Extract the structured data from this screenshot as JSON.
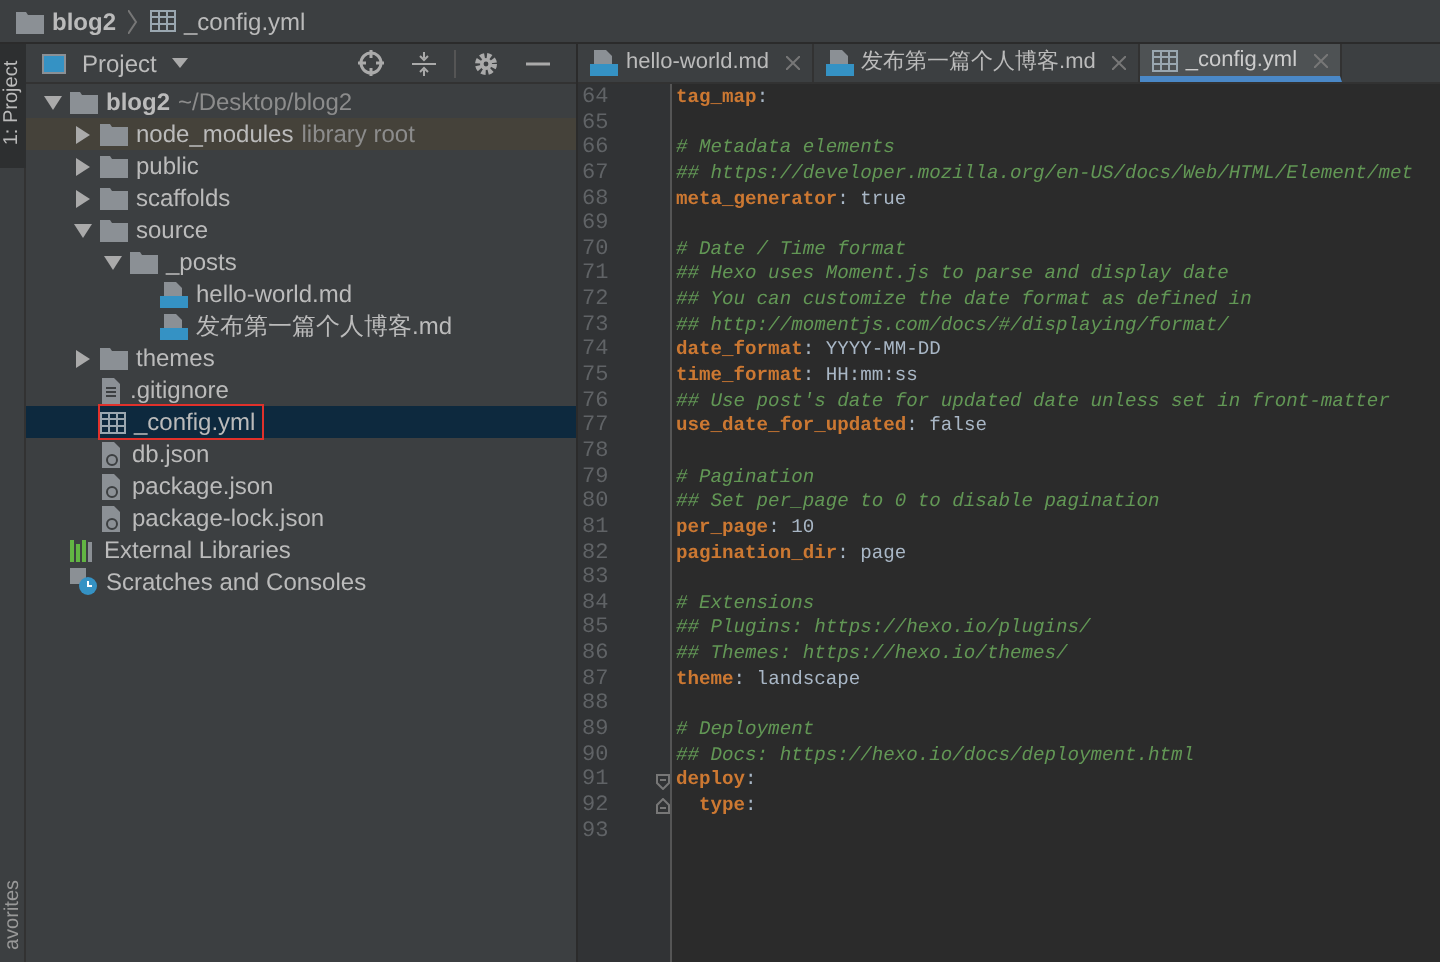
{
  "breadcrumb": [
    {
      "label": "blog2",
      "kind": "folder"
    },
    {
      "label": "_config.yml",
      "kind": "table"
    }
  ],
  "side_strip": {
    "top_tab": "1: Project",
    "bottom_tab": "avorites"
  },
  "project_panel": {
    "title": "Project",
    "tree": [
      {
        "label": "blog2",
        "note": "~/Desktop/blog2",
        "kind": "folder",
        "expanded": true,
        "selected": false,
        "children": [
          {
            "label": "node_modules",
            "note": "library root",
            "kind": "folder",
            "expanded": false,
            "hovered": true,
            "selected": false
          },
          {
            "label": "public",
            "kind": "folder",
            "expanded": false,
            "selected": false
          },
          {
            "label": "scaffolds",
            "kind": "folder",
            "expanded": false,
            "selected": false
          },
          {
            "label": "source",
            "kind": "folder",
            "expanded": true,
            "selected": false,
            "children": [
              {
                "label": "_posts",
                "kind": "folder",
                "expanded": true,
                "selected": false,
                "children": [
                  {
                    "label": "hello-world.md",
                    "kind": "md",
                    "selected": false
                  },
                  {
                    "label": "发布第一篇个人博客.md",
                    "kind": "md",
                    "selected": false
                  }
                ]
              }
            ]
          },
          {
            "label": "themes",
            "kind": "folder",
            "expanded": false,
            "selected": false
          },
          {
            "label": ".gitignore",
            "kind": "text",
            "selected": false
          },
          {
            "label": "_config.yml",
            "kind": "table",
            "selected": true,
            "annotated": true
          },
          {
            "label": "db.json",
            "kind": "json",
            "selected": false
          },
          {
            "label": "package.json",
            "kind": "json",
            "selected": false
          },
          {
            "label": "package-lock.json",
            "kind": "json",
            "selected": false
          }
        ]
      },
      {
        "label": "External Libraries",
        "kind": "libraries",
        "selected": false
      },
      {
        "label": "Scratches and Consoles",
        "kind": "scratches",
        "selected": false
      }
    ]
  },
  "editor_tabs": [
    {
      "label": "hello-world.md",
      "kind": "md",
      "selected": false
    },
    {
      "label": "发布第一篇个人博客.md",
      "kind": "md",
      "selected": false
    },
    {
      "label": "_config.yml",
      "kind": "table",
      "selected": true
    }
  ],
  "code_lines": [
    {
      "number": "64",
      "segments": [
        {
          "kind": "key",
          "text": "tag_map"
        },
        {
          "kind": "plain",
          "text": ":"
        }
      ]
    },
    {
      "number": "65"
    },
    {
      "number": "66",
      "segments": [
        {
          "kind": "comment",
          "text": "# Metadata elements"
        }
      ]
    },
    {
      "number": "67",
      "segments": [
        {
          "kind": "comment",
          "text": "## https://developer.mozilla.org/en-US/docs/Web/HTML/Element/met"
        }
      ]
    },
    {
      "number": "68",
      "segments": [
        {
          "kind": "key",
          "text": "meta_generator"
        },
        {
          "kind": "plain",
          "text": ": true"
        }
      ]
    },
    {
      "number": "69"
    },
    {
      "number": "70",
      "segments": [
        {
          "kind": "comment",
          "text": "# Date / Time format"
        }
      ]
    },
    {
      "number": "71",
      "segments": [
        {
          "kind": "comment",
          "text": "## Hexo uses Moment.js to parse and display date"
        }
      ]
    },
    {
      "number": "72",
      "segments": [
        {
          "kind": "comment",
          "text": "## You can customize the date format as defined in"
        }
      ]
    },
    {
      "number": "73",
      "segments": [
        {
          "kind": "comment",
          "text": "## http://momentjs.com/docs/#/displaying/format/"
        }
      ]
    },
    {
      "number": "74",
      "segments": [
        {
          "kind": "key",
          "text": "date_format"
        },
        {
          "kind": "plain",
          "text": ": YYYY-MM-DD"
        }
      ]
    },
    {
      "number": "75",
      "segments": [
        {
          "kind": "key",
          "text": "time_format"
        },
        {
          "kind": "plain",
          "text": ": HH:mm:ss"
        }
      ]
    },
    {
      "number": "76",
      "segments": [
        {
          "kind": "comment",
          "text": "## Use post's date for updated date unless set in front-matter"
        }
      ]
    },
    {
      "number": "77",
      "segments": [
        {
          "kind": "key",
          "text": "use_date_for_updated"
        },
        {
          "kind": "plain",
          "text": ": false"
        }
      ]
    },
    {
      "number": "78"
    },
    {
      "number": "79",
      "segments": [
        {
          "kind": "comment",
          "text": "# Pagination"
        }
      ]
    },
    {
      "number": "80",
      "segments": [
        {
          "kind": "comment",
          "text": "## Set per_page to 0 to disable pagination"
        }
      ]
    },
    {
      "number": "81",
      "segments": [
        {
          "kind": "key",
          "text": "per_page"
        },
        {
          "kind": "plain",
          "text": ": 10"
        }
      ]
    },
    {
      "number": "82",
      "segments": [
        {
          "kind": "key",
          "text": "pagination_dir"
        },
        {
          "kind": "plain",
          "text": ": page"
        }
      ]
    },
    {
      "number": "83"
    },
    {
      "number": "84",
      "segments": [
        {
          "kind": "comment",
          "text": "# Extensions"
        }
      ]
    },
    {
      "number": "85",
      "segments": [
        {
          "kind": "comment",
          "text": "## Plugins: https://hexo.io/plugins/"
        }
      ]
    },
    {
      "number": "86",
      "segments": [
        {
          "kind": "comment",
          "text": "## Themes: https://hexo.io/themes/"
        }
      ]
    },
    {
      "number": "87",
      "segments": [
        {
          "kind": "key",
          "text": "theme"
        },
        {
          "kind": "plain",
          "text": ": landscape"
        }
      ]
    },
    {
      "number": "88"
    },
    {
      "number": "89",
      "segments": [
        {
          "kind": "comment",
          "text": "# Deployment"
        }
      ]
    },
    {
      "number": "90",
      "segments": [
        {
          "kind": "comment",
          "text": "## Docs: https://hexo.io/docs/deployment.html"
        }
      ]
    },
    {
      "number": "91",
      "kind": "fold_start",
      "segments": [
        {
          "kind": "key",
          "text": "deploy"
        },
        {
          "kind": "plain",
          "text": ":"
        }
      ]
    },
    {
      "number": "92",
      "kind": "fold_end",
      "segments": [
        {
          "kind": "key",
          "text": "type"
        },
        {
          "kind": "plain",
          "text": ":"
        }
      ]
    },
    {
      "number": "93"
    }
  ]
}
